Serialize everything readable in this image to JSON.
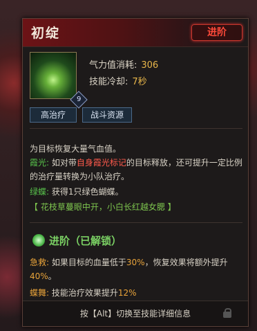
{
  "tooltip": {
    "title": "初绽",
    "advance_badge": "进阶",
    "icon": "healing-skill-icon",
    "level": "9",
    "stats": [
      {
        "label": "气力值消耗:",
        "value": "306"
      },
      {
        "label": "技能冷却:",
        "value": "7秒"
      }
    ],
    "tags": [
      "高治疗",
      "战斗资源"
    ],
    "description": "为目标恢复大量气血值。",
    "xiaguang": {
      "label": "霞光:",
      "text_before": "如对带",
      "highlight": "自身霞光标记",
      "text_after": "的目标释放，还可提升一定比例的治疗量转换为小队治疗。"
    },
    "lvdie": {
      "label": "绿蝶:",
      "text": "获得1只绿色蝴蝶。"
    },
    "flavor": "【 花枝草蔓眼中开，小白长红越女腮 】",
    "advance": {
      "title": "进阶（已解锁）",
      "jijiu": {
        "label": "急救:",
        "t1": "如果目标的血量低于",
        "v1": "30%",
        "t2": "，恢复效果将额外提升",
        "v2": "40%",
        "t3": "。"
      },
      "diewu": {
        "label": "蝶舞:",
        "t1": "技能治疗效果提升",
        "v1": "12%"
      }
    },
    "footer": "按【Alt】切换至技能详细信息"
  }
}
